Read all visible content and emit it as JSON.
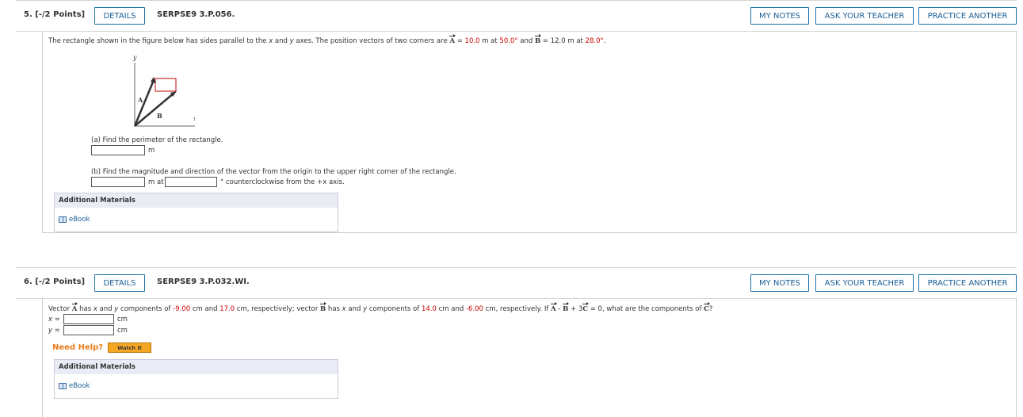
{
  "q5": {
    "number": "5.",
    "points": "[-/2 Points]",
    "details": "DETAILS",
    "code": "SERPSE9 3.P.056.",
    "my_notes": "MY NOTES",
    "ask_teacher": "ASK YOUR TEACHER",
    "practice": "PRACTICE ANOTHER",
    "problem_pre": "The rectangle shown in the figure below has sides parallel to the ",
    "x": "x",
    "and": " and ",
    "y": "y",
    "axes_text": " axes. The position vectors of two corners are ",
    "A": "A",
    "eq": " = ",
    "A_val": "10.0",
    "m_at": " m  at ",
    "A_ang": "50.0°",
    "and2": " and ",
    "B": "B",
    "B_val": "12.0",
    "m_at2": " m  at ",
    "B_ang": "28.0°",
    "period": ".",
    "fig_y": "y",
    "fig_x": "x",
    "fig_A": "A",
    "fig_B": "B",
    "part_a": "(a) Find the perimeter of the rectangle.",
    "unit_m": "m",
    "part_b": "(b) Find the magnitude and direction of the vector from the origin to the upper right corner of the rectangle.",
    "m_at_label": "m at",
    "ccw": "° counterclockwise from the +x axis.",
    "additional": "Additional Materials",
    "ebook": "eBook"
  },
  "q6": {
    "number": "6.",
    "points": "[-/2 Points]",
    "details": "DETAILS",
    "code": "SERPSE9 3.P.032.WI.",
    "my_notes": "MY NOTES",
    "ask_teacher": "ASK YOUR TEACHER",
    "practice": "PRACTICE ANOTHER",
    "p1": "Vector ",
    "A": "A",
    "p2": " has ",
    "x": "x",
    "and": " and ",
    "y": "y",
    "p3": " components of ",
    "ax": "-9.00",
    "p4": " cm and ",
    "ay": "17.0",
    "p5": " cm, respectively; vector ",
    "B": "B",
    "p6": " has ",
    "p7": " components of ",
    "bx": "14.0",
    "p8": " cm and ",
    "by": "-6.00",
    "p9": " cm, respectively. If ",
    "eq_a": "A",
    "minus": " - ",
    "eq_b": "B",
    "plus": " + 3",
    "eq_c": "C",
    "eq_zero": " = 0, what are the components of ",
    "c_q": "C",
    "qmark": "?",
    "x_label": "x =",
    "y_label": "y =",
    "unit_cm": "cm",
    "unit_cm2": "cm",
    "need_help": "Need Help?",
    "watch_it": "Watch It",
    "additional": "Additional Materials",
    "ebook": "eBook"
  }
}
